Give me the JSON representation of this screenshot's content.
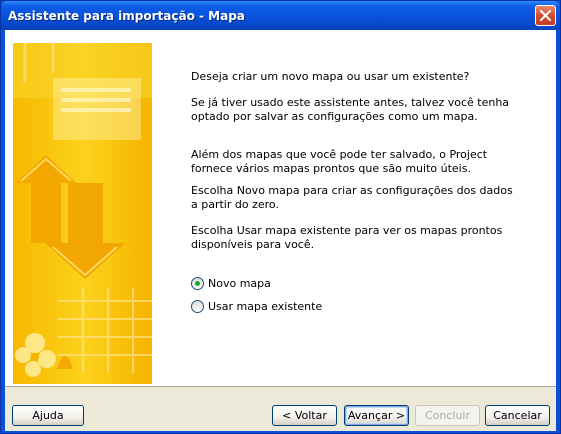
{
  "window": {
    "title": "Assistente para importação - Mapa"
  },
  "content": {
    "question": "Deseja criar um novo mapa ou usar um existente?",
    "paragraph1": "Se já tiver usado este assistente antes, talvez você tenha optado por salvar as configurações como um mapa.",
    "paragraph2": "Além dos mapas que você pode ter salvado, o Project fornece vários mapas prontos que são muito úteis.",
    "paragraph3": "Escolha Novo mapa para criar as configurações dos dados a partir do zero.",
    "paragraph4": "Escolha Usar mapa existente para ver os mapas prontos disponíveis para você."
  },
  "options": [
    {
      "label": "Novo mapa",
      "checked": true
    },
    {
      "label": "Usar mapa existente",
      "checked": false
    }
  ],
  "buttons": {
    "help": "Ajuda",
    "back": "< Voltar",
    "next": "Avançar >",
    "finish": "Concluir",
    "cancel": "Cancelar"
  },
  "colors": {
    "title_bar": "#0a53df",
    "close_button": "#d5452d",
    "dialog_bg": "#ece9d8",
    "art_yellow": "#f7c600",
    "art_orange": "#f2a800"
  }
}
